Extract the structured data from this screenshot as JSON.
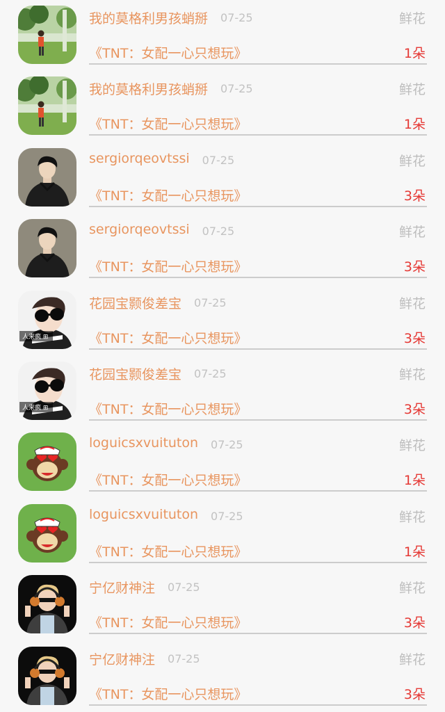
{
  "gifts": [
    {
      "user": "我的莫格利男孩蛸掰",
      "date": "07-25",
      "gift_type": "鲜花",
      "novel": "《TNT：女配一心只想玩》",
      "count": "1朵",
      "avatar": "outdoor-person"
    },
    {
      "user": "我的莫格利男孩蛸掰",
      "date": "07-25",
      "gift_type": "鲜花",
      "novel": "《TNT：女配一心只想玩》",
      "count": "1朵",
      "avatar": "outdoor-person"
    },
    {
      "user": "sergiorqeovtssi",
      "date": "07-25",
      "gift_type": "鲜花",
      "novel": "《TNT：女配一心只想玩》",
      "count": "3朵",
      "avatar": "man-dark-coat"
    },
    {
      "user": "sergiorqeovtssi",
      "date": "07-25",
      "gift_type": "鲜花",
      "novel": "《TNT：女配一心只想玩》",
      "count": "3朵",
      "avatar": "man-dark-coat"
    },
    {
      "user": "花园宝颢俊差宝",
      "date": "07-25",
      "gift_type": "鲜花",
      "novel": "《TNT：女配一心只想玩》",
      "count": "3朵",
      "avatar": "sunglasses-boy"
    },
    {
      "user": "花园宝颢俊差宝",
      "date": "07-25",
      "gift_type": "鲜花",
      "novel": "《TNT：女配一心只想玩》",
      "count": "3朵",
      "avatar": "sunglasses-boy"
    },
    {
      "user": "loguicsxvuituton",
      "date": "07-25",
      "gift_type": "鲜花",
      "novel": "《TNT：女配一心只想玩》",
      "count": "1朵",
      "avatar": "cartoon-monkey"
    },
    {
      "user": "loguicsxvuituton",
      "date": "07-25",
      "gift_type": "鲜花",
      "novel": "《TNT：女配一心只想玩》",
      "count": "1朵",
      "avatar": "cartoon-monkey"
    },
    {
      "user": "宁亿财神注",
      "date": "07-25",
      "gift_type": "鲜花",
      "novel": "《TNT：女配一心只想玩》",
      "count": "3朵",
      "avatar": "headphone-boy"
    },
    {
      "user": "宁亿财神注",
      "date": "07-25",
      "gift_type": "鲜花",
      "novel": "《TNT：女配一心只想玩》",
      "count": "3朵",
      "avatar": "headphone-boy"
    }
  ],
  "avatar_watermark": "人来疯 ⊞"
}
